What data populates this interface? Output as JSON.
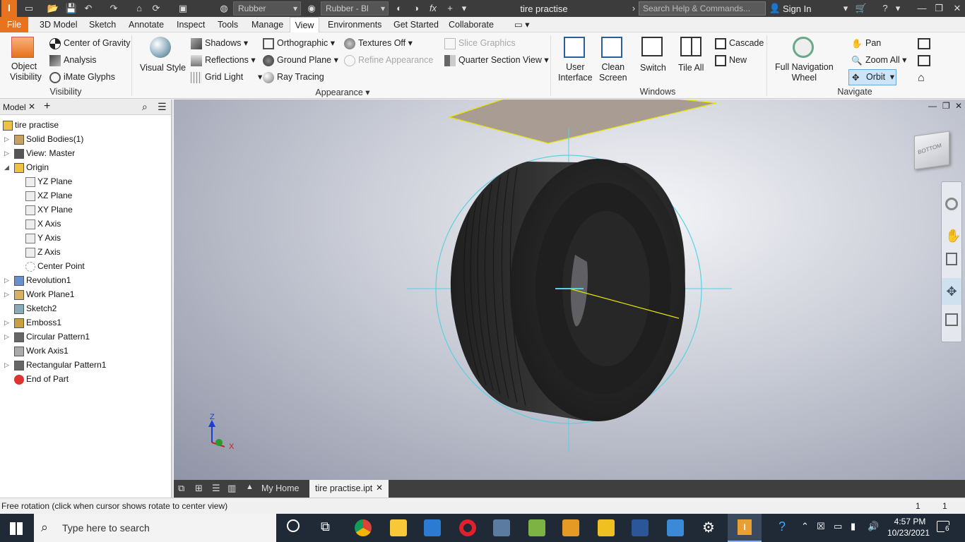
{
  "titlebar": {
    "material": "Rubber",
    "appearance": "Rubber - Bl",
    "title": "tire practise",
    "search_placeholder": "Search Help & Commands...",
    "sign_in": "Sign In"
  },
  "menu": {
    "tabs": [
      "File",
      "3D Model",
      "Sketch",
      "Annotate",
      "Inspect",
      "Tools",
      "Manage",
      "View",
      "Environments",
      "Get Started",
      "Collaborate"
    ],
    "active": "View"
  },
  "ribbon": {
    "visibility": {
      "object_visibility": "Object\nVisibility",
      "center_of_gravity": "Center of Gravity",
      "analysis": "Analysis",
      "imate_glyphs": "iMate Glyphs",
      "group": "Visibility"
    },
    "appearance": {
      "visual_style": "Visual Style",
      "shadows": "Shadows",
      "reflections": "Reflections",
      "grid_light": "Grid Light",
      "orthographic": "Orthographic",
      "ground_plane": "Ground Plane",
      "ray_tracing": "Ray Tracing",
      "textures_off": "Textures Off",
      "refine_appearance": "Refine Appearance",
      "slice_graphics": "Slice Graphics",
      "quarter_section": "Quarter Section View",
      "group": "Appearance"
    },
    "windows": {
      "user_interface": "User\nInterface",
      "clean_screen": "Clean\nScreen",
      "switch": "Switch",
      "tile_all": "Tile All",
      "cascade": "Cascade",
      "new": "New",
      "group": "Windows"
    },
    "navigate": {
      "full_nav_wheel": "Full Navigation\nWheel",
      "pan": "Pan",
      "zoom_all": "Zoom All",
      "orbit": "Orbit",
      "group": "Navigate"
    }
  },
  "browser": {
    "tab": "Model",
    "tree": [
      {
        "label": "tire practise",
        "level": 0,
        "icon": "part-icon",
        "exp": ""
      },
      {
        "label": "Solid Bodies(1)",
        "level": 1,
        "icon": "solid-bodies-icon",
        "exp": "▷"
      },
      {
        "label": "View: Master",
        "level": 1,
        "icon": "view-icon",
        "exp": "▷"
      },
      {
        "label": "Origin",
        "level": 1,
        "icon": "folder-icon",
        "exp": "◢"
      },
      {
        "label": "YZ Plane",
        "level": 2,
        "icon": "plane-icon",
        "exp": ""
      },
      {
        "label": "XZ Plane",
        "level": 2,
        "icon": "plane-icon",
        "exp": ""
      },
      {
        "label": "XY Plane",
        "level": 2,
        "icon": "plane-icon",
        "exp": ""
      },
      {
        "label": "X Axis",
        "level": 2,
        "icon": "axis-icon",
        "exp": ""
      },
      {
        "label": "Y Axis",
        "level": 2,
        "icon": "axis-icon",
        "exp": ""
      },
      {
        "label": "Z Axis",
        "level": 2,
        "icon": "axis-icon",
        "exp": ""
      },
      {
        "label": "Center Point",
        "level": 2,
        "icon": "point-icon",
        "exp": ""
      },
      {
        "label": "Revolution1",
        "level": 1,
        "icon": "revolve-icon",
        "exp": "▷"
      },
      {
        "label": "Work Plane1",
        "level": 1,
        "icon": "workplane-icon",
        "exp": "▷"
      },
      {
        "label": "Sketch2",
        "level": 1,
        "icon": "sketch-icon",
        "exp": ""
      },
      {
        "label": "Emboss1",
        "level": 1,
        "icon": "emboss-icon",
        "exp": "▷"
      },
      {
        "label": "Circular Pattern1",
        "level": 1,
        "icon": "circular-pattern-icon",
        "exp": "▷"
      },
      {
        "label": "Work Axis1",
        "level": 1,
        "icon": "workaxis-icon",
        "exp": ""
      },
      {
        "label": "Rectangular Pattern1",
        "level": 1,
        "icon": "rect-pattern-icon",
        "exp": "▷"
      },
      {
        "label": "End of Part",
        "level": 1,
        "icon": "end-of-part-icon",
        "exp": ""
      }
    ]
  },
  "doctabs": {
    "home": "My Home",
    "active": "tire practise.ipt"
  },
  "status": {
    "message": "Free rotation (click when cursor shows rotate to center view)",
    "count1": "1",
    "count2": "1"
  },
  "viewcube": {
    "face": "BOTTOM"
  },
  "triad": {
    "x": "X",
    "z": "Z"
  },
  "taskbar": {
    "search_placeholder": "Type here to search",
    "time": "4:57 PM",
    "date": "10/23/2021",
    "notifications": "6"
  },
  "colors": {
    "accent": "#e8731e",
    "highlight": "#cce4f7",
    "titlebar": "#3c3c3c"
  }
}
